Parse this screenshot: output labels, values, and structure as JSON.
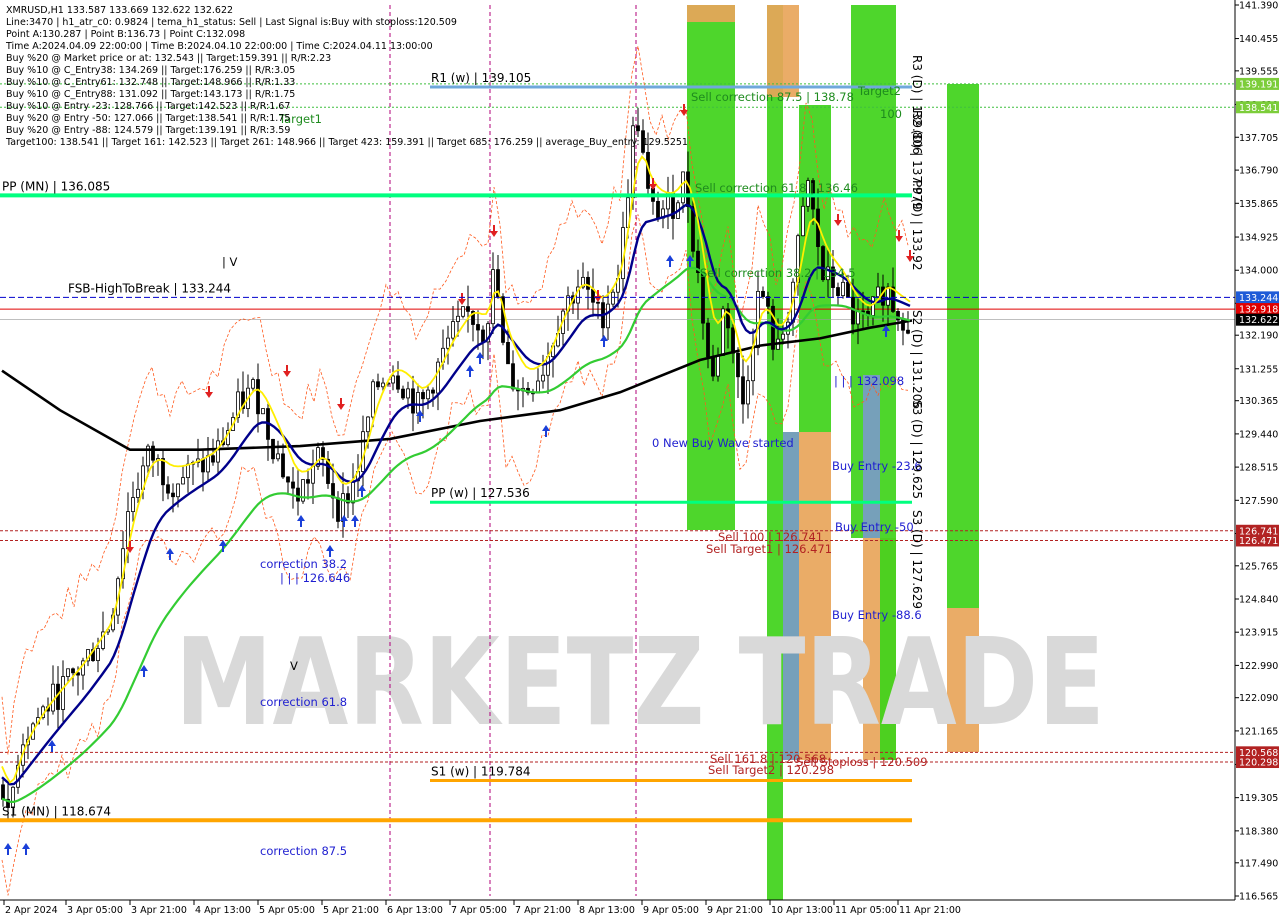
{
  "chart_data": {
    "type": "candlestick",
    "symbol": "XMRUSD,H1",
    "ylim": [
      116.5,
      141.5
    ],
    "info_lines": [
      "XMRUSD,H1  133.587 133.669 132.622 132.622",
      "Line:3470  |  h1_atr_c0: 0.9824  |  tema_h1_status: Sell  |  Last Signal is:Buy with stoploss:120.509",
      "Point A:130.287  |  Point B:136.73  |  Point C:132.098",
      "Time A:2024.04.09 22:00:00  |  Time B:2024.04.10 22:00:00  |  Time C:2024.04.11 13:00:00",
      "Buy %20 @ Market price or at: 132.543  ||  Target:159.391  ||  R/R:2.23",
      "Buy %10 @ C_Entry38: 134.269  ||  Target:176.259  ||  R/R:3.05",
      "Buy %10 @ C_Entry61: 132.748  ||  Target:148.966  ||  R/R:1.33",
      "Buy %10 @ C_Entry88: 131.092  ||  Target:143.173  ||  R/R:1.75",
      "Buy %10 @ Entry -23: 128.766  ||  Target:142.523  ||  R/R:1.67",
      "Buy %20 @ Entry -50: 127.066  ||  Target:138.541  ||  R/R:1.75",
      "Buy %20 @ Entry -88: 124.579  ||  Target:139.191  ||  R/R:3.59",
      "Target100: 138.541  ||  Target 161: 142.523  ||  Target 261: 148.966  ||  Target 423: 159.391  ||  Target 685: 176.259  ||  average_Buy_entry: 129.5251"
    ],
    "target1_label": "Target1",
    "y_ticks": [
      "141.390",
      "140.455",
      "139.555",
      "138.620",
      "137.705",
      "136.790",
      "135.865",
      "134.925",
      "134.000",
      "133.080",
      "132.190",
      "131.255",
      "130.365",
      "129.440",
      "128.515",
      "127.590",
      "126.665",
      "125.765",
      "124.840",
      "123.915",
      "122.990",
      "122.090",
      "121.165",
      "120.230",
      "119.305",
      "118.380",
      "117.490",
      "116.565"
    ],
    "x_ticks": [
      "2 Apr 2024",
      "3 Apr 05:00",
      "3 Apr 21:00",
      "4 Apr 13:00",
      "5 Apr 05:00",
      "5 Apr 21:00",
      "6 Apr 13:00",
      "7 Apr 05:00",
      "7 Apr 21:00",
      "8 Apr 13:00",
      "9 Apr 05:00",
      "9 Apr 21:00",
      "10 Apr 13:00",
      "11 Apr 05:00",
      "11 Apr 21:00"
    ],
    "levels": [
      {
        "label": "R1 (w) | 139.105",
        "value": 139.105,
        "color": "#6fa8dc"
      },
      {
        "label": "PP (MN) | 136.085",
        "value": 136.085,
        "color": "#00ff7f"
      },
      {
        "label": "FSB-HighToBreak | 133.244",
        "value": 133.244,
        "color": "#0000cd"
      },
      {
        "label": "PP (w) | 127.536",
        "value": 127.536,
        "color": "#00ff7f"
      },
      {
        "label": "S1 (w) | 119.784",
        "value": 119.784,
        "color": "#ffa500"
      },
      {
        "label": "S1 (MN) | 118.674",
        "value": 118.674,
        "color": "#ffa500"
      }
    ],
    "price_tags": [
      {
        "text": "139.191",
        "value": 139.191,
        "color": "#7ccd3a"
      },
      {
        "text": "138.541",
        "value": 138.541,
        "color": "#7ccd3a"
      },
      {
        "text": "133.244",
        "value": 133.244,
        "color": "#1e5bd7"
      },
      {
        "text": "132.918",
        "value": 132.918,
        "color": "#e00000"
      },
      {
        "text": "132.622",
        "value": 132.622,
        "color": "#000000"
      },
      {
        "text": "126.741",
        "value": 126.741,
        "color": "#b22222"
      },
      {
        "text": "126.471",
        "value": 126.471,
        "color": "#b22222"
      },
      {
        "text": "120.568",
        "value": 120.568,
        "color": "#b22222"
      },
      {
        "text": "120.298",
        "value": 120.298,
        "color": "#b22222"
      }
    ],
    "annotations": [
      {
        "text": "Sell correction 87.5 | 138.78",
        "color": "#1e8b1e"
      },
      {
        "text": "Sell correction 61.8 | 136.46",
        "color": "#1e8b1e"
      },
      {
        "text": "Sell correction 38.2 | 134.5",
        "color": "#1e8b1e"
      },
      {
        "text": "correction 38.2",
        "color": "#1e1ed0"
      },
      {
        "text": "| | | 126.646",
        "color": "#1e1ed0"
      },
      {
        "text": "correction 61.8",
        "color": "#1e1ed0"
      },
      {
        "text": "correction 87.5",
        "color": "#1e1ed0"
      },
      {
        "text": "0 New Buy Wave started",
        "color": "#1e1ed0"
      },
      {
        "text": "Buy Entry -23.6",
        "color": "#1e1ed0"
      },
      {
        "text": "Buy Entry -50",
        "color": "#1e1ed0"
      },
      {
        "text": "Buy Entry -88.6",
        "color": "#1e1ed0"
      },
      {
        "text": "| | | 132.098",
        "color": "#1e1ed0"
      },
      {
        "text": "Sell 100 | 126.741",
        "color": "#b22222"
      },
      {
        "text": "Sell Target1 | 126.471",
        "color": "#b22222"
      },
      {
        "text": "Sell 161.8 | 120.568",
        "color": "#b22222"
      },
      {
        "text": "Sell Target2 | 120.298",
        "color": "#b22222"
      },
      {
        "text": "Sell Stoploss | 120.509",
        "color": "#b22222"
      },
      {
        "text": "Target2",
        "color": "#1e8b1e"
      },
      {
        "text": "100",
        "color": "#1e8b1e"
      },
      {
        "text": "| V",
        "color": "#000000"
      },
      {
        "text": "V",
        "color": "#000000"
      }
    ],
    "vertical_texts": [
      "R3 (D) | 139.806",
      "R2 (D) | 137.979",
      "PP (D) | 133.92",
      "S2 (D) | 131.206",
      "S3 (D) | 129.625",
      "S3 (D) | 127.629"
    ],
    "watermark": "MARKETZ TRADE"
  }
}
